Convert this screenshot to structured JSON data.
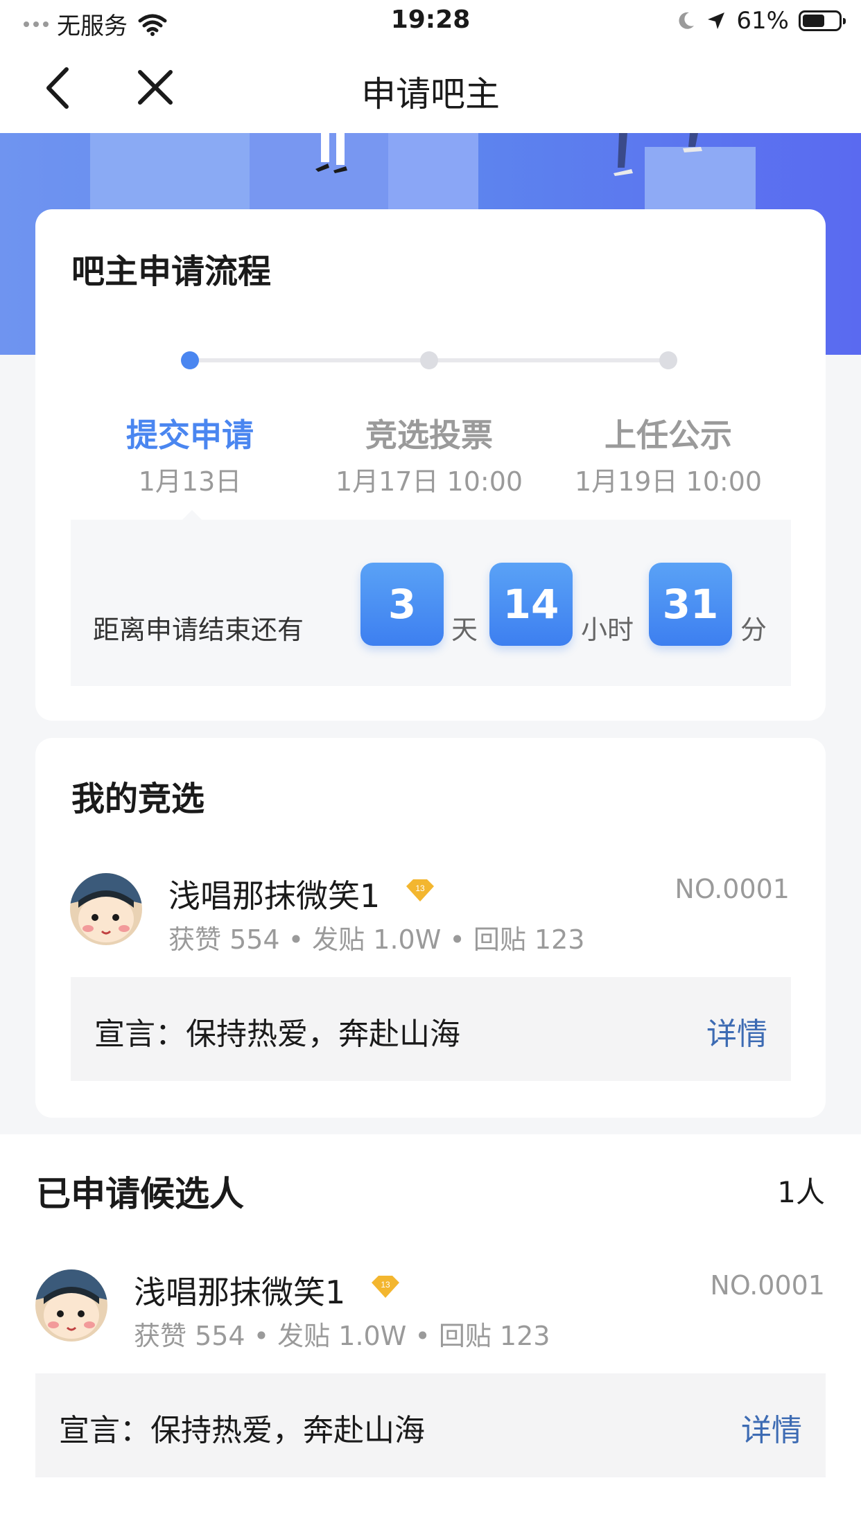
{
  "status_bar": {
    "carrier": "无服务",
    "time": "19:28",
    "battery": "61%",
    "battery_level": 0.61
  },
  "nav": {
    "title": "申请吧主"
  },
  "process": {
    "title": "吧主申请流程",
    "steps": [
      {
        "name": "提交申请",
        "date": "1月13日",
        "active": true
      },
      {
        "name": "竞选投票",
        "date": "1月17日 10:00",
        "active": false
      },
      {
        "name": "上任公示",
        "date": "1月19日 10:00",
        "active": false
      }
    ],
    "countdown": {
      "label": "距离申请结束还有",
      "days": "3",
      "days_unit": "天",
      "hours": "14",
      "hours_unit": "小时",
      "minutes": "31",
      "minutes_unit": "分"
    }
  },
  "my_campaign": {
    "title": "我的竞选",
    "candidate": {
      "name": "浅唱那抹微笑1",
      "level": "13",
      "number": "NO.0001",
      "stats": "获赞 554 • 发贴 1.0W • 回贴 123",
      "slogan": "宣言：保持热爱，奔赴山海",
      "detail": "详情"
    }
  },
  "applicants": {
    "title": "已申请候选人",
    "count": "1人",
    "list": [
      {
        "name": "浅唱那抹微笑1",
        "level": "13",
        "number": "NO.0001",
        "stats": "获赞 554 • 发贴 1.0W • 回贴 123",
        "slogan": "宣言：保持热爱，奔赴山海",
        "detail": "详情"
      }
    ]
  },
  "colors": {
    "accent": "#4a86f0",
    "link": "#3d6bb3",
    "badge": "#f3b62f"
  }
}
